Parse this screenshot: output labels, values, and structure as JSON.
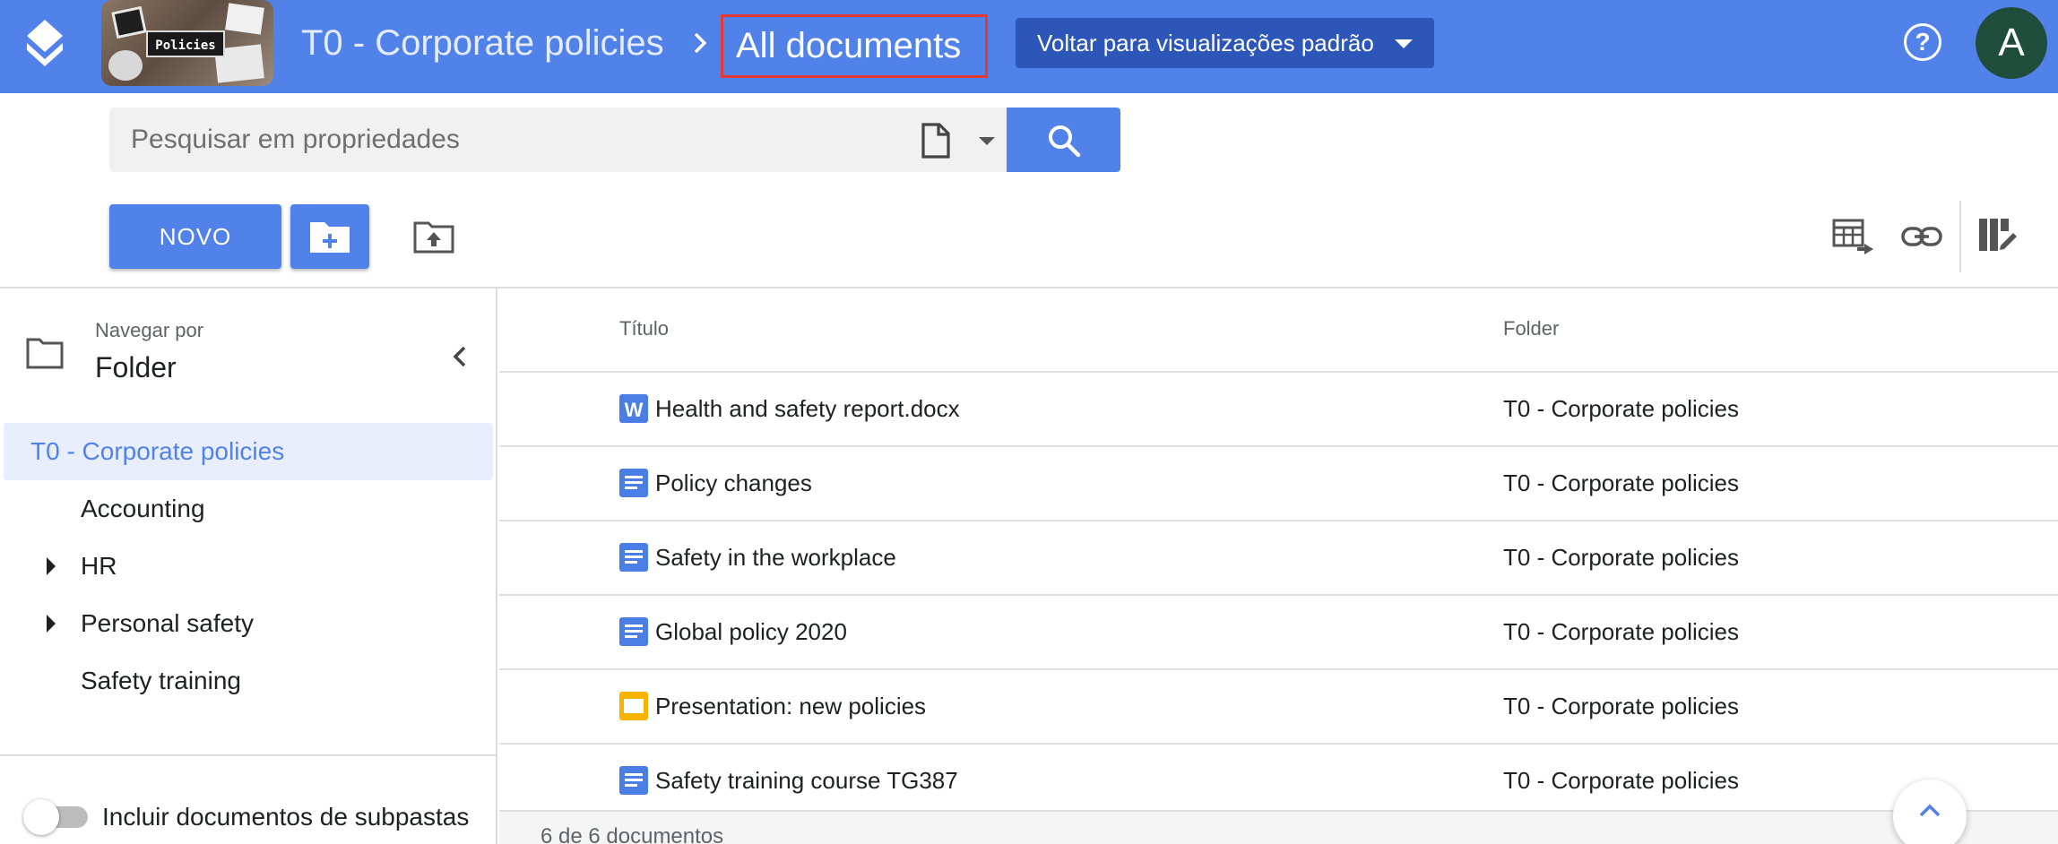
{
  "header": {
    "thumbnail_text": "Policies",
    "breadcrumb_parent": "T0 - Corporate policies",
    "breadcrumb_current": "All documents",
    "view_select_label": "Voltar para visualizações padrão",
    "avatar_initial": "A",
    "help_label": "?"
  },
  "search": {
    "placeholder": "Pesquisar em propriedades"
  },
  "toolbar": {
    "new_label": "NOVO"
  },
  "sidebar": {
    "browse_label": "Navegar por",
    "browse_value": "Folder",
    "tree": [
      {
        "label": "T0 - Corporate policies",
        "selected": true
      },
      {
        "label": "Accounting"
      },
      {
        "label": "HR",
        "expandable": true
      },
      {
        "label": "Personal safety",
        "expandable": true
      },
      {
        "label": "Safety training"
      }
    ],
    "toggle_label": "Incluir documentos de subpastas"
  },
  "table": {
    "headers": {
      "title": "Título",
      "folder": "Folder"
    },
    "rows": [
      {
        "icon": "word-doc-icon",
        "title": "Health and safety report.docx",
        "folder": "T0 - Corporate policies"
      },
      {
        "icon": "google-doc-icon",
        "title": "Policy changes",
        "folder": "T0 - Corporate policies"
      },
      {
        "icon": "google-doc-icon",
        "title": "Safety in the workplace",
        "folder": "T0 - Corporate policies"
      },
      {
        "icon": "google-doc-icon",
        "title": "Global policy 2020",
        "folder": "T0 - Corporate policies"
      },
      {
        "icon": "google-slides-icon",
        "title": "Presentation: new policies",
        "folder": "T0 - Corporate policies"
      },
      {
        "icon": "google-doc-icon",
        "title": "Safety training course TG387",
        "folder": "T0 - Corporate policies"
      }
    ],
    "footer": "6 de 6 documentos"
  },
  "colors": {
    "accent": "#5182e9",
    "header_dark": "#2c56b8",
    "avatar_bg": "#1e4d3c",
    "highlight_border": "#e53935",
    "doc_blue": "#4a7ee4",
    "slides_yellow": "#f4b400"
  }
}
